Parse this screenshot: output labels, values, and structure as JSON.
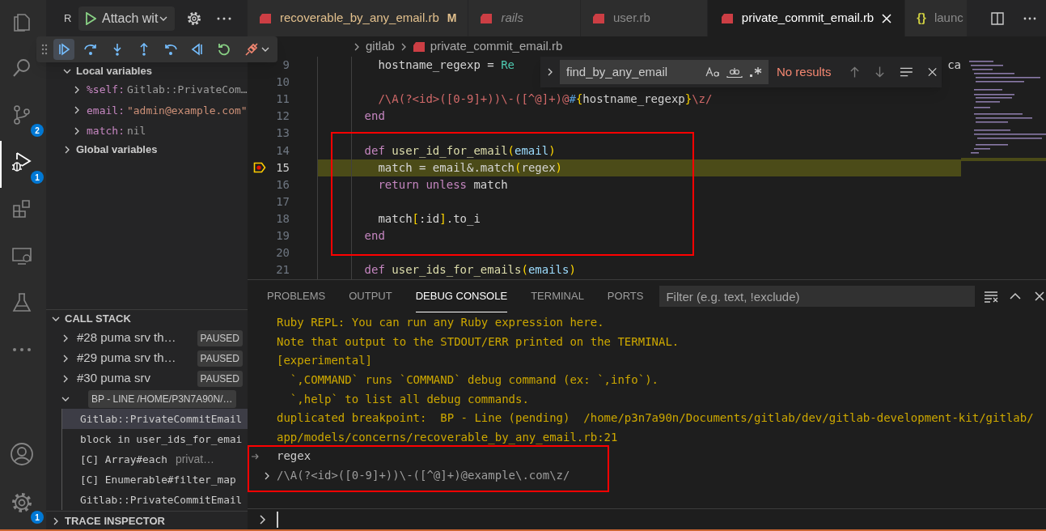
{
  "activity_bar": {
    "items": [
      {
        "kind": "files",
        "selected": false
      },
      {
        "kind": "search",
        "selected": false
      },
      {
        "kind": "source-control",
        "selected": false,
        "badge": "2"
      },
      {
        "kind": "run-debug",
        "selected": true,
        "badge": "1"
      },
      {
        "kind": "extensions",
        "selected": false
      },
      {
        "kind": "remote",
        "selected": false
      },
      {
        "kind": "testing",
        "selected": false
      },
      {
        "kind": "more",
        "selected": false
      }
    ],
    "bottom": [
      {
        "kind": "account",
        "selected": false
      },
      {
        "kind": "settings",
        "selected": false,
        "badge": "1"
      }
    ]
  },
  "sidebar": {
    "title": "R",
    "launch_config": "Attach wit",
    "scopes": [
      {
        "label": "Local variables",
        "expanded": true,
        "items": [
          {
            "name": "%self:",
            "value": "Gitlab::PrivateCom…",
            "kind": "object"
          },
          {
            "name": "email:",
            "value": "\"admin@example.com\"",
            "kind": "string"
          },
          {
            "name": "match:",
            "value": "nil",
            "kind": "nil"
          }
        ]
      },
      {
        "label": "Global variables",
        "expanded": false
      }
    ],
    "call_stack": {
      "title": "CALL STACK",
      "expanded": true,
      "threads": [
        {
          "name": "#28 puma srv th…",
          "status": "PAUSED",
          "expanded": false
        },
        {
          "name": "#29 puma srv th…",
          "status": "PAUSED",
          "expanded": false
        },
        {
          "name": "#30 puma srv",
          "status": "PAUSED",
          "expanded": false
        },
        {
          "name": "BP - LINE /HOME/P3N7A90N/…",
          "expanded": true,
          "frames": [
            {
              "name": "Gitlab::PrivateCommitEmail",
              "selected": true
            },
            {
              "name": "block in user_ids_for_emai",
              "selected": false
            },
            {
              "name": "[C] Array#each",
              "source": "privat…",
              "selected": false
            },
            {
              "name": "[C] Enumerable#filter_map",
              "selected": false
            },
            {
              "name": "Gitlab::PrivateCommitEmail",
              "selected": false
            }
          ]
        }
      ]
    },
    "trace_inspector": {
      "title": "TRACE INSPECTOR",
      "expanded": false
    }
  },
  "debug_toolbar": {
    "buttons": [
      {
        "kind": "continue"
      },
      {
        "kind": "step-over"
      },
      {
        "kind": "step-into"
      },
      {
        "kind": "step-out"
      },
      {
        "kind": "step-back"
      },
      {
        "kind": "reverse-continue"
      },
      {
        "kind": "restart"
      },
      {
        "kind": "disconnect"
      }
    ]
  },
  "tabs": [
    {
      "label": "recoverable_by_any_email.rb",
      "kind": "ruby",
      "badge": "M",
      "preview": false,
      "selected": false
    },
    {
      "label": "rails",
      "kind": "ruby",
      "preview": true,
      "selected": false
    },
    {
      "label": "user.rb",
      "kind": "ruby",
      "preview": false,
      "selected": false
    },
    {
      "label": "private_commit_email.rb",
      "kind": "ruby",
      "preview": false,
      "selected": true
    },
    {
      "label": "launc",
      "kind": "json",
      "icon_text": "{}",
      "preview": false,
      "selected": false
    }
  ],
  "breadcrumb": [
    {
      "label": "gitlab",
      "kind": "folder"
    },
    {
      "label": "private_commit_email.rb",
      "kind": "ruby"
    }
  ],
  "find_widget": {
    "value": "find_by_any_email",
    "status": "No results"
  },
  "editor": {
    "highlight_frame": true,
    "lines": [
      {
        "number": "9",
        "current": false,
        "tokens": [
          {
            "kind": "plain",
            "t": "        hostname_regexp = "
          },
          {
            "kind": "const",
            "t": "Re"
          }
        ],
        "tail": "ca"
      },
      {
        "number": "10",
        "current": false
      },
      {
        "number": "11",
        "current": false,
        "tokens": [
          {
            "kind": "regex",
            "t": "        /\\A(?<id>([0-9]+))\\-([^@]+)@"
          },
          {
            "kind": "interp",
            "t": "#"
          },
          {
            "kind": "brace",
            "t": "{"
          },
          {
            "kind": "plain",
            "t": "hostname_regexp"
          },
          {
            "kind": "brace",
            "t": "}"
          },
          {
            "kind": "regex",
            "t": "\\z/"
          }
        ]
      },
      {
        "number": "12",
        "current": false,
        "tokens": [
          {
            "kind": "kw",
            "t": "      end"
          }
        ]
      },
      {
        "number": "13",
        "current": false
      },
      {
        "number": "14",
        "current": false,
        "tokens": [
          {
            "kind": "kw",
            "t": "      def"
          },
          {
            "kind": "fn",
            "t": " user_id_for_email"
          },
          {
            "kind": "brace",
            "t": "("
          },
          {
            "kind": "param",
            "t": "email"
          },
          {
            "kind": "brace",
            "t": ")"
          }
        ]
      },
      {
        "number": "15",
        "current": true,
        "tokens": [
          {
            "kind": "plain",
            "t": "        match = email&.match"
          },
          {
            "kind": "brace",
            "t": "("
          },
          {
            "kind": "plain",
            "t": "regex"
          },
          {
            "kind": "brace",
            "t": ")"
          }
        ]
      },
      {
        "number": "16",
        "current": false,
        "tokens": [
          {
            "kind": "kw",
            "t": "        return unless"
          },
          {
            "kind": "plain",
            "t": " match"
          }
        ]
      },
      {
        "number": "17",
        "current": false
      },
      {
        "number": "18",
        "current": false,
        "tokens": [
          {
            "kind": "plain",
            "t": "        match"
          },
          {
            "kind": "brace",
            "t": "["
          },
          {
            "kind": "plain",
            "t": ":id"
          },
          {
            "kind": "brace",
            "t": "]"
          },
          {
            "kind": "plain",
            "t": ".to_i"
          }
        ]
      },
      {
        "number": "19",
        "current": false,
        "tokens": [
          {
            "kind": "kw",
            "t": "      end"
          }
        ]
      },
      {
        "number": "20",
        "current": false
      },
      {
        "number": "21",
        "current": false,
        "tokens": [
          {
            "kind": "kw",
            "t": "      def"
          },
          {
            "kind": "fn",
            "t": " user_ids_for_emails"
          },
          {
            "kind": "brace",
            "t": "("
          },
          {
            "kind": "param",
            "t": "emails"
          },
          {
            "kind": "brace",
            "t": ")"
          }
        ]
      }
    ]
  },
  "panel": {
    "highlight_frame": true,
    "tabs": [
      {
        "label": "PROBLEMS",
        "selected": false
      },
      {
        "label": "OUTPUT",
        "selected": false
      },
      {
        "label": "DEBUG CONSOLE",
        "selected": true
      },
      {
        "label": "TERMINAL",
        "selected": false
      },
      {
        "label": "PORTS",
        "selected": false
      }
    ],
    "filter_placeholder": "Filter (e.g. text, !exclude)",
    "console": [
      {
        "kind": "output",
        "text": "Ruby REPL: You can run any Ruby expression here."
      },
      {
        "kind": "output",
        "text": "Note that output to the STDOUT/ERR printed on the TERMINAL."
      },
      {
        "kind": "output",
        "text": "[experimental]"
      },
      {
        "kind": "output",
        "text": "  `,COMMAND` runs `COMMAND` debug command (ex: `,info`)."
      },
      {
        "kind": "output",
        "text": "  `,help` to list all debug commands."
      },
      {
        "kind": "output",
        "text": "duplicated breakpoint:  BP - Line (pending)  /home/p3n7a90n/Documents/gitlab/dev/gitlab-development-kit/gitlab/"
      },
      {
        "kind": "output",
        "text": "app/models/concerns/recoverable_by_any_email.rb:21"
      },
      {
        "kind": "input",
        "text": "regex"
      },
      {
        "kind": "result",
        "text": "/\\A(?<id>([0-9]+))\\-([^@]+)@example\\.com\\z/"
      }
    ]
  }
}
